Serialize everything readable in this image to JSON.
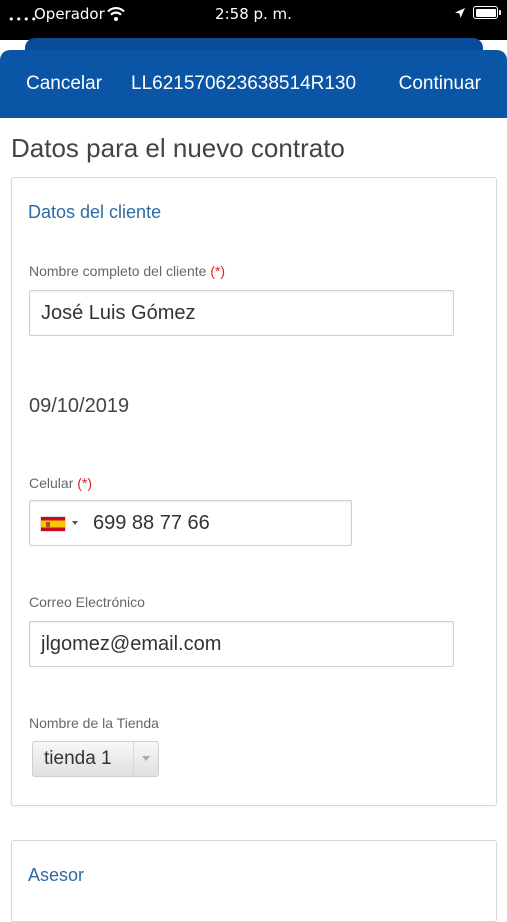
{
  "status_bar": {
    "carrier": "Operador",
    "time": "2:58 p. m."
  },
  "nav": {
    "cancel_label": "Cancelar",
    "reference": "LL621570623638514R130",
    "continue_label": "Continuar"
  },
  "page_title": "Datos para el nuevo contrato",
  "client_section": {
    "title": "Datos del cliente",
    "name_label": "Nombre completo del cliente",
    "required_marker": "(*)",
    "name_value": "José Luis Gómez",
    "date_value": "09/10/2019",
    "phone_label": "Celular",
    "phone_value": "699 88 77 66",
    "email_label": "Correo Electrónico",
    "email_value": "jlgomez@email.com",
    "store_label": "Nombre de la Tienda",
    "store_value": "tienda 1"
  },
  "advisor_section": {
    "title": "Asesor"
  }
}
